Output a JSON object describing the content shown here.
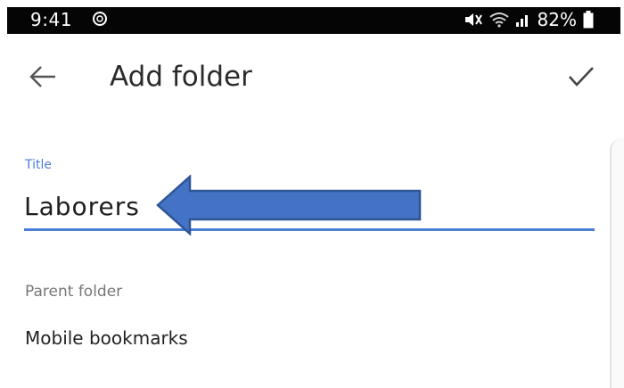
{
  "status_bar": {
    "time": "9:41",
    "battery": "82%",
    "notification_icon": "circle-notification-icon",
    "icons": [
      "mute-icon",
      "wifi-icon",
      "signal-icon",
      "battery-icon"
    ]
  },
  "app_bar": {
    "title": "Add folder",
    "back_icon": "arrow-left-icon",
    "save_icon": "check-icon"
  },
  "form": {
    "title_label": "Title",
    "title_value": "Laborers",
    "parent_label": "Parent folder",
    "parent_value": "Mobile bookmarks"
  },
  "annotation": {
    "arrow_color": "#4472c4",
    "arrow_border": "#2f5597"
  },
  "colors": {
    "accent": "#4a7fd4",
    "status_bar": "#050505"
  }
}
